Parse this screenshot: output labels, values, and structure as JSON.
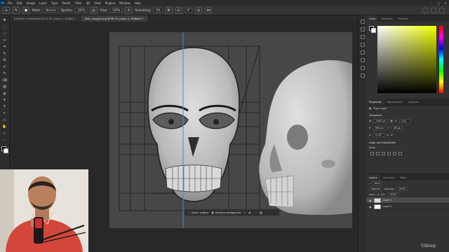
{
  "menubar": {
    "logo": "Ps",
    "items": [
      "File",
      "Edit",
      "Image",
      "Layer",
      "Type",
      "Select",
      "Filter",
      "3D",
      "View",
      "Plugins",
      "Window",
      "Help"
    ],
    "window_controls": [
      "–",
      "□",
      "✕"
    ]
  },
  "options": {
    "mode_label": "Mode:",
    "mode_value": "Normal",
    "opacity_label": "Opacity:",
    "opacity_value": "100%",
    "flow_label": "Flow:",
    "flow_value": "100%",
    "smoothing_label": "Smoothing:",
    "smoothing_value": "0%",
    "angle_value": "0°"
  },
  "tabs": [
    {
      "label": "Untitled-1 Screenshot @ 33.3% (Layer 1, RGB/8) *",
      "active": false
    },
    {
      "label": "Skull_image2.png @ 66.7% (Layer 2, RGB/8#) *",
      "active": true
    }
  ],
  "toolbar": {
    "tools": [
      "✥",
      "⬚",
      "◌",
      "✂",
      "⌗",
      "✎",
      "⊘",
      "✐",
      "✎",
      "⌫",
      "▨",
      "◍",
      "✦",
      "T",
      "↖",
      "▭",
      "✋",
      "⌕",
      "⋯"
    ]
  },
  "taskbar": {
    "select_subject": "Select subject",
    "remove_background": "Remove background",
    "icons": [
      "⊹",
      "◐",
      "⋯",
      "▦"
    ]
  },
  "color_panel": {
    "tabs": [
      "Color",
      "Swatches",
      "Patterns"
    ]
  },
  "properties_panel": {
    "tabs": [
      "Properties",
      "Adjustments",
      "Libraries"
    ],
    "layer_type": "Pixel Layer",
    "transform_title": "Transform",
    "w_label": "W",
    "w_value": "2000 px",
    "h_label": "H",
    "h_value": "992 px",
    "x_label": "X",
    "x_value": "0 px",
    "y_label": "Y",
    "y_value": "48 px",
    "angle_value": "0.00°",
    "align_title": "Align and Distribute",
    "align_label": "Align:"
  },
  "layers_panel": {
    "tabs": [
      "Layers",
      "Channels",
      "Paths"
    ],
    "kind_label": "Kind",
    "blend_mode": "Normal",
    "opacity_label": "Opacity:",
    "opacity_value": "100%",
    "lock_label": "Lock:",
    "fill_label": "Fill:",
    "fill_value": "100%",
    "layers": [
      {
        "name": "Layer 1",
        "active": true
      },
      {
        "name": "Layer 1",
        "active": false
      }
    ]
  },
  "watermark": "Udemy",
  "colors": {
    "accent": "#31a8ff",
    "guide": "#3f8fd6",
    "canvas_bg": "#474747",
    "shirt": "#d2473a"
  }
}
